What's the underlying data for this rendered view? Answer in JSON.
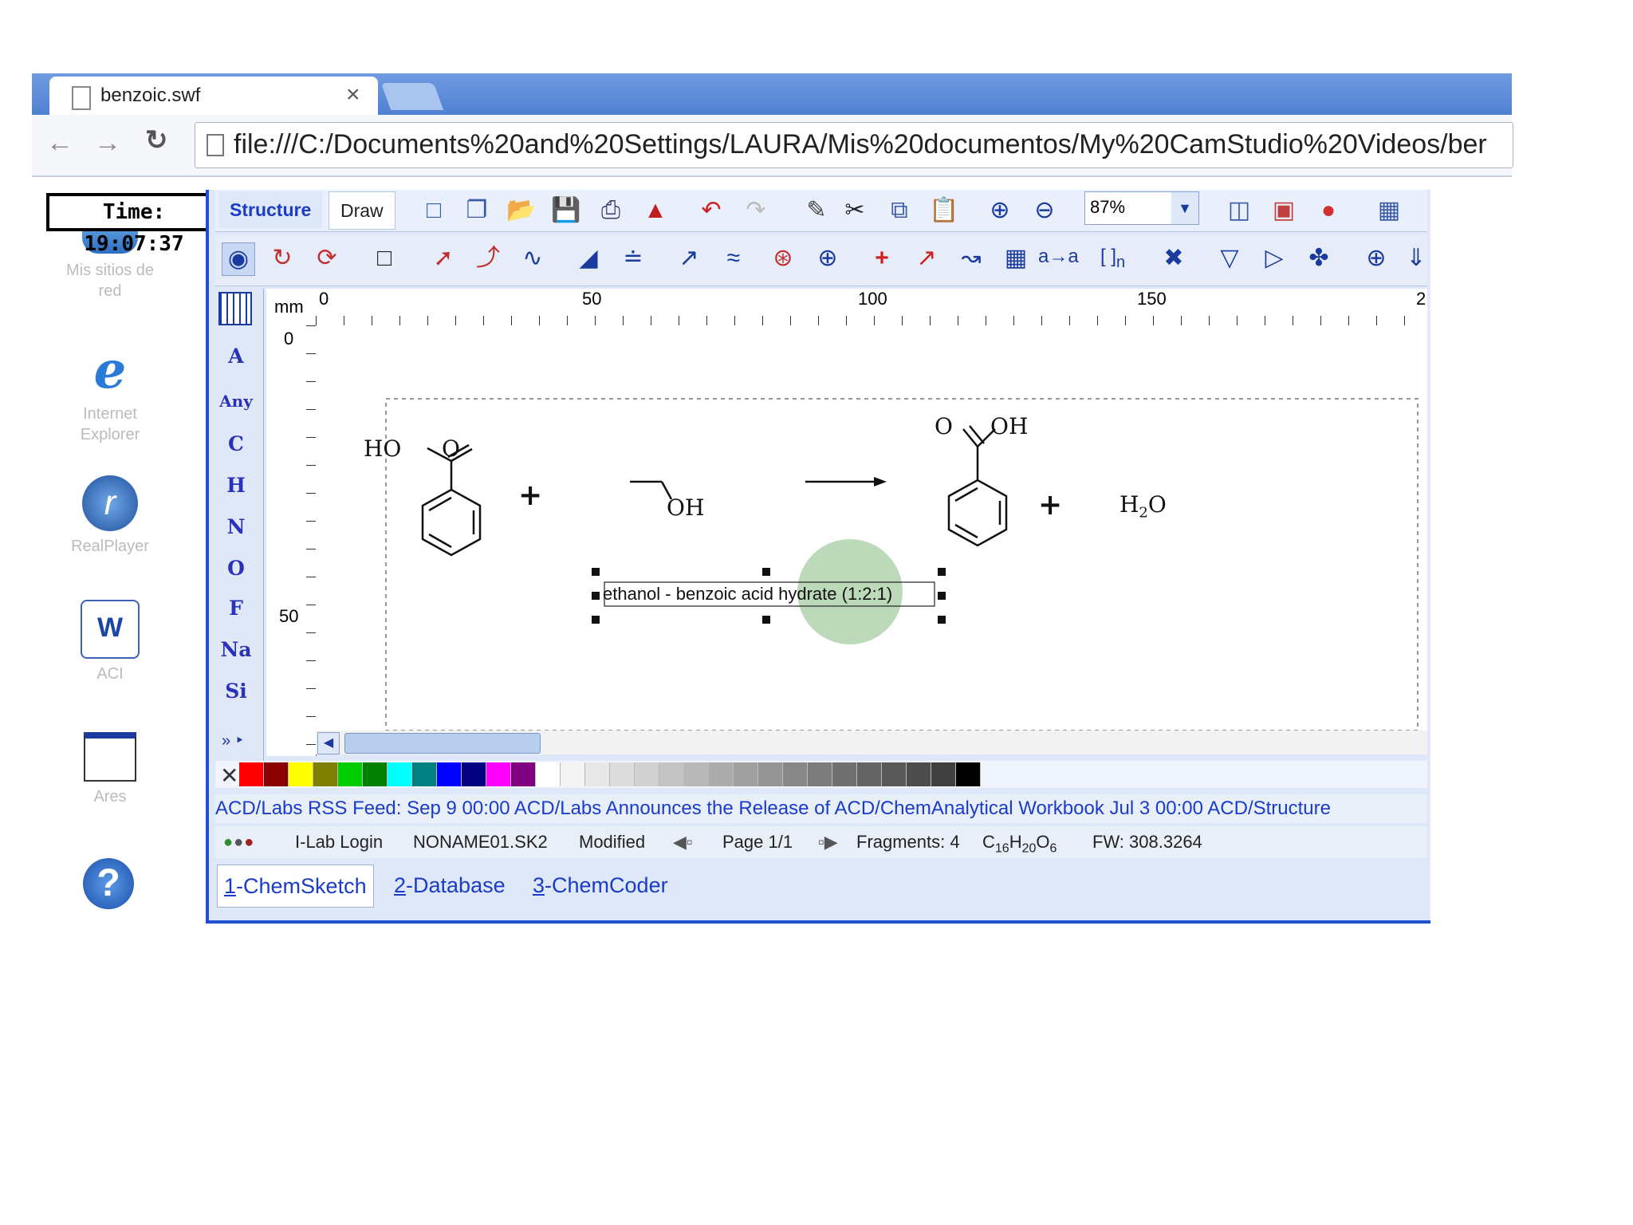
{
  "browser": {
    "tab_title": "benzoic.swf",
    "tab_close": "×",
    "address": "file:///C:/Documents%20and%20Settings/LAURA/Mis%20documentos/My%20CamStudio%20Videos/ber"
  },
  "desktop": {
    "time": "Time: 19:07:37",
    "icons": [
      {
        "label": "Mis sitios de red"
      },
      {
        "label": "Internet Explorer"
      },
      {
        "label": "RealPlayer"
      },
      {
        "label": "ACI"
      },
      {
        "label": "Ares"
      }
    ]
  },
  "app": {
    "mode_tabs": [
      "Structure",
      "Draw"
    ],
    "zoom": "87%",
    "ruler": {
      "unit": "mm",
      "h_ticks": [
        "0",
        "50",
        "100",
        "150",
        "2"
      ],
      "v_ticks": [
        "0",
        "50"
      ]
    },
    "atoms": [
      "A",
      "Any",
      "C",
      "H",
      "N",
      "O",
      "F",
      "Na",
      "Si"
    ],
    "canvas": {
      "mol1_labels": [
        "HO",
        "O"
      ],
      "plus1": "+",
      "mol2_label": "OH",
      "mol3_labels": [
        "O",
        "OH"
      ],
      "plus2": "+",
      "water": {
        "h": "H",
        "sub": "2",
        "o": "O"
      },
      "caption": "ethanol - benzoic acid hydrate (1:2:1)"
    },
    "palette_colors": [
      "#ff0000",
      "#8b0000",
      "#ffff00",
      "#808000",
      "#00cc00",
      "#008000",
      "#00ffff",
      "#008080",
      "#0000ff",
      "#000080",
      "#ff00ff",
      "#800080",
      "#ffffff",
      "#f4f4f4",
      "#e8e8e8",
      "#dcdcdc",
      "#d0d0d0",
      "#c4c4c4",
      "#b8b8b8",
      "#acacac",
      "#a0a0a0",
      "#949494",
      "#888888",
      "#7c7c7c",
      "#707070",
      "#646464",
      "#585858",
      "#4c4c4c",
      "#404040",
      "#000000"
    ],
    "rss": "ACD/Labs RSS Feed: Sep 9 00:00 ACD/Labs Announces the Release of ACD/ChemAnalytical Workbook  Jul 3 00:00 ACD/Structure",
    "status": {
      "login": "I-Lab Login",
      "file": "NONAME01.SK2",
      "modified": "Modified",
      "page": "Page 1/1",
      "fragments": "Fragments: 4",
      "formula": {
        "c": "C",
        "c_n": "16",
        "h": "H",
        "h_n": "20",
        "o": "O",
        "o_n": "6"
      },
      "fw": "FW: 308.3264"
    },
    "bottom_tabs": [
      {
        "num": "1",
        "label": "-ChemSketch"
      },
      {
        "num": "2",
        "label": "-Database"
      },
      {
        "num": "3",
        "label": "-ChemCoder"
      }
    ]
  }
}
